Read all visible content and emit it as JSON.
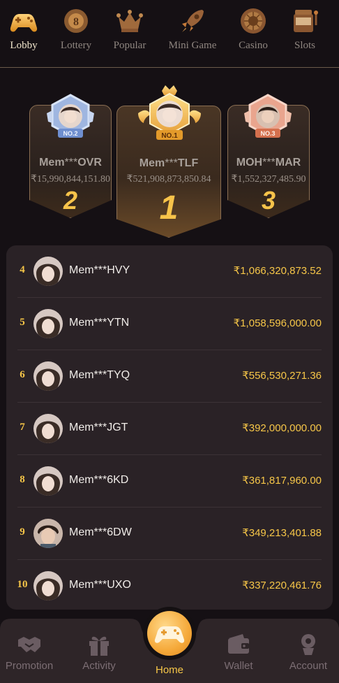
{
  "categories": [
    {
      "label": "Lobby",
      "icon": "gamepad-icon",
      "active": true
    },
    {
      "label": "Lottery",
      "icon": "lottery-ball-icon",
      "active": false
    },
    {
      "label": "Popular",
      "icon": "crown-icon",
      "active": false
    },
    {
      "label": "Mini Game",
      "icon": "rocket-icon",
      "active": false
    },
    {
      "label": "Casino",
      "icon": "roulette-icon",
      "active": false
    },
    {
      "label": "Slots",
      "icon": "slot-machine-icon",
      "active": false
    }
  ],
  "podium": {
    "first": {
      "name_pre": "Mem",
      "name_mask": "***",
      "name_post": "TLF",
      "amount": "₹521,908,873,850.84",
      "rank": "1",
      "badge": "NO.1"
    },
    "second": {
      "name_pre": "Mem",
      "name_mask": "***",
      "name_post": "OVR",
      "amount": "₹15,990,844,151.80",
      "rank": "2",
      "badge": "NO.2"
    },
    "third": {
      "name_pre": "MOH",
      "name_mask": "***",
      "name_post": "MAR",
      "amount": "₹1,552,327,485.90",
      "rank": "3",
      "badge": "NO.3"
    }
  },
  "leaderboard": [
    {
      "rank": "4",
      "name": "Mem***HVY",
      "amount": "₹1,066,320,873.52"
    },
    {
      "rank": "5",
      "name": "Mem***YTN",
      "amount": "₹1,058,596,000.00"
    },
    {
      "rank": "6",
      "name": "Mem***TYQ",
      "amount": "₹556,530,271.36"
    },
    {
      "rank": "7",
      "name": "Mem***JGT",
      "amount": "₹392,000,000.00"
    },
    {
      "rank": "8",
      "name": "Mem***6KD",
      "amount": "₹361,817,960.00"
    },
    {
      "rank": "9",
      "name": "Mem***6DW",
      "amount": "₹349,213,401.88"
    },
    {
      "rank": "10",
      "name": "Mem***UXO",
      "amount": "₹337,220,461.76"
    }
  ],
  "tabs": {
    "promotion": "Promotion",
    "activity": "Activity",
    "home": "Home",
    "wallet": "Wallet",
    "account": "Account"
  },
  "colors": {
    "gold": "#f6c648",
    "background": "#151014",
    "card": "#2a2226",
    "muted": "#7c6e74"
  }
}
